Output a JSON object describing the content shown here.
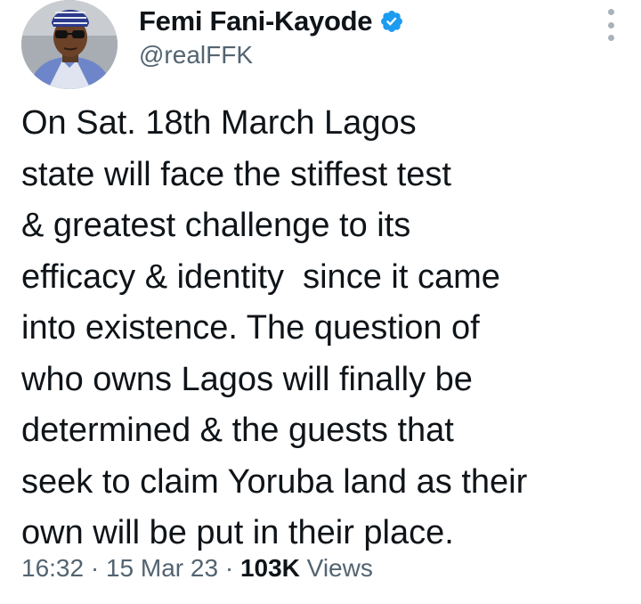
{
  "author": {
    "display_name": "Femi Fani-Kayode",
    "handle": "@realFFK",
    "verified_icon": "verified-badge-icon",
    "verified_color": "#1d9bf0"
  },
  "tweet": {
    "lines": [
      "On Sat. 18th March Lagos",
      "state will face the stiffest test",
      "& greatest challenge to its",
      "efficacy & identity  since it came",
      "into existence. The question of",
      "who owns Lagos will finally be",
      "determined & the guests that",
      "seek to claim Yoruba land as their",
      "own will be put in their place."
    ]
  },
  "meta": {
    "time": "16:32",
    "sep1": " · ",
    "date": "15 Mar 23",
    "sep2": " · ",
    "views_count": "103K",
    "views_label": " Views"
  },
  "icons": {
    "more": "more-vertical-icon"
  },
  "colors": {
    "text": "#0f1419",
    "secondary": "#536471",
    "accent": "#1d9bf0"
  }
}
